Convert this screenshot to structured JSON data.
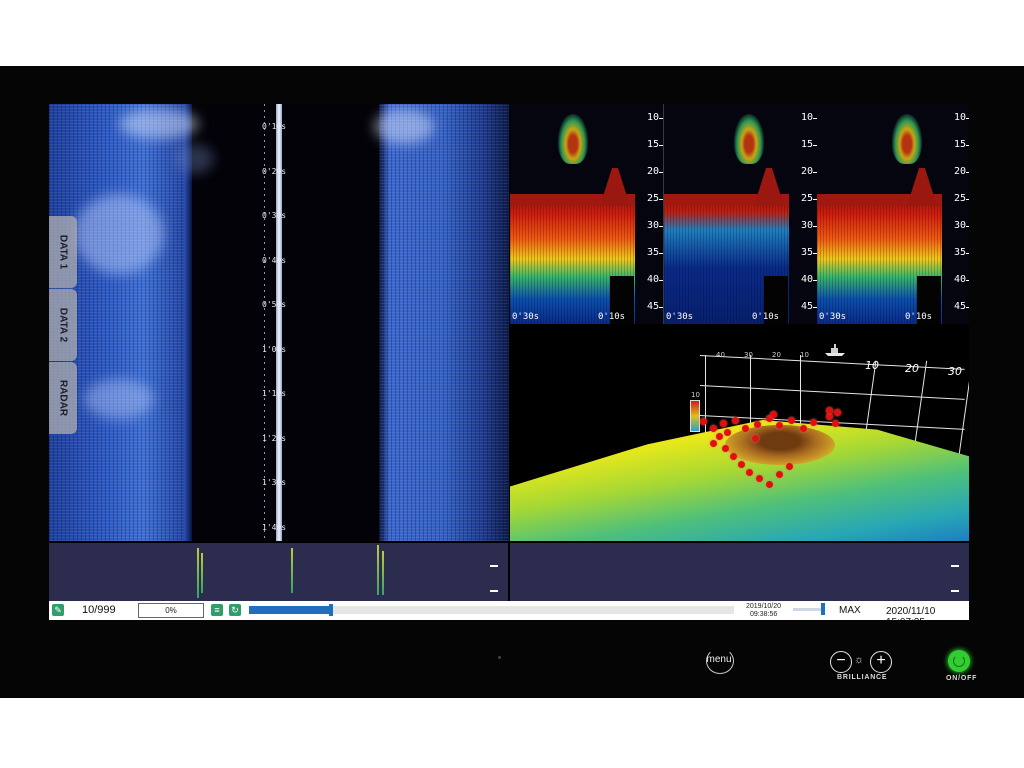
{
  "sidescan": {
    "time_labels": [
      "0'10s",
      "0'20s",
      "0'30s",
      "0'40s",
      "0'50s",
      "1'00s",
      "1'10s",
      "1'20s",
      "1'30s",
      "1'40s"
    ]
  },
  "tabs": [
    {
      "label": "DATA 1"
    },
    {
      "label": "DATA 2"
    },
    {
      "label": "RADAR"
    }
  ],
  "echograms": [
    {
      "left_time": "0'30s",
      "right_time": "0'10s"
    },
    {
      "left_time": "0'30s",
      "right_time": "0'10s"
    },
    {
      "left_time": "0'30s",
      "right_time": "0'10s"
    }
  ],
  "echo_scale": [
    "10",
    "15",
    "20",
    "25",
    "30",
    "35",
    "40",
    "45"
  ],
  "view3d": {
    "axis_top": [
      "40",
      "30",
      "20",
      "10",
      "10",
      "20",
      "30"
    ],
    "depth_label": "10"
  },
  "statusbar": {
    "counter": "10/999",
    "progress": "0%",
    "playback_position": 0.17,
    "recorded_date": "2019/10/20",
    "recorded_time": "09:38:56",
    "brilliance_level": "MAX",
    "datetime": "2020/11/10 15:07:25"
  },
  "hardware": {
    "menu_label": "menu",
    "brilliance_label": "BRILLIANCE",
    "minus_symbol": "−",
    "plus_symbol": "+",
    "sun_symbol": "☼",
    "power_label": "ON/OFF"
  },
  "colors": {
    "accent": "#1f6fbf",
    "power_led": "#33cc33",
    "status_icon": "#2f9e6b",
    "strip_bg": "#2c2d4e"
  }
}
